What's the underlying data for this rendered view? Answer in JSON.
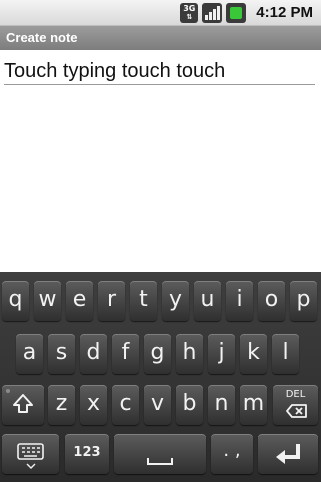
{
  "status_bar": {
    "network_label": "3G",
    "time": "4:12 PM",
    "icons": [
      "network-3g-icon",
      "signal-icon",
      "battery-icon"
    ]
  },
  "title_bar": {
    "title": "Create note"
  },
  "note": {
    "text": "Touch typing touch touch"
  },
  "keyboard": {
    "row1": [
      "q",
      "w",
      "e",
      "r",
      "t",
      "y",
      "u",
      "i",
      "o",
      "p"
    ],
    "row2": [
      "a",
      "s",
      "d",
      "f",
      "g",
      "h",
      "j",
      "k",
      "l"
    ],
    "row3": [
      "z",
      "x",
      "c",
      "v",
      "b",
      "n",
      "m"
    ],
    "del_label": "DEL",
    "sym_label": "123",
    "punct_label": ". ,",
    "icons": [
      "shift-icon",
      "backspace-icon",
      "keyboard-settings-icon",
      "space-icon",
      "enter-icon"
    ]
  }
}
